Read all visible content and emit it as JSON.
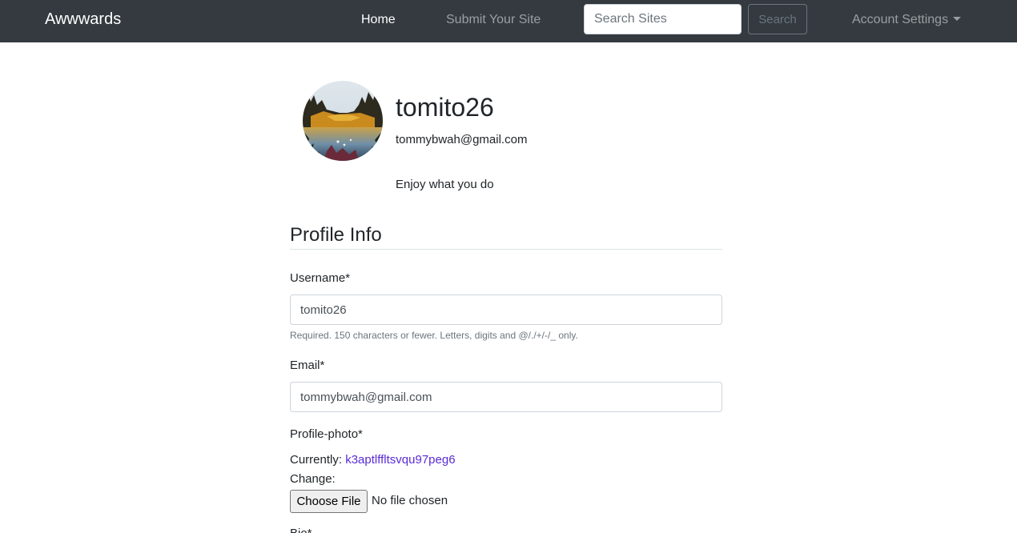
{
  "navbar": {
    "brand": "Awwwards",
    "links": [
      {
        "label": "Home",
        "active": true
      },
      {
        "label": "Submit Your Site",
        "active": false
      }
    ],
    "search_placeholder": "Search Sites",
    "search_button": "Search",
    "account_menu": "Account Settings"
  },
  "profile": {
    "username": "tomito26",
    "email": "tommybwah@gmail.com",
    "bio": "Enjoy what you do"
  },
  "form": {
    "title": "Profile Info",
    "username_label": "Username*",
    "username_value": "tomito26",
    "username_help": "Required. 150 characters or fewer. Letters, digits and @/./+/-/_ only.",
    "email_label": "Email*",
    "email_value": "tommybwah@gmail.com",
    "photo_label": "Profile-photo*",
    "currently_label": "Currently:",
    "current_file": "k3aptlffltsvqu97peg6",
    "change_label": "Change:",
    "choose_file_button": "Choose File",
    "file_status": "No file chosen",
    "next_label_partial": "Bio*"
  },
  "colors": {
    "navbar_bg": "#343a40",
    "link_color": "#5a2bd6"
  },
  "icons": {
    "account_menu": "caret-down-icon"
  }
}
